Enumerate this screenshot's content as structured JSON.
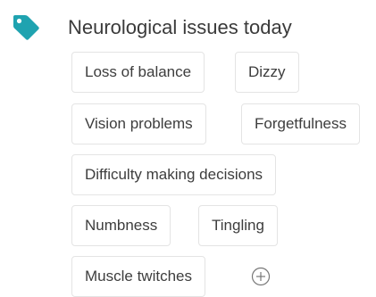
{
  "section": {
    "icon": "tag-icon",
    "title": "Neurological issues today"
  },
  "symptoms": [
    "Loss of balance",
    "Dizzy",
    "Vision problems",
    "Forgetfulness",
    "Difficulty making decisions",
    "Numbness",
    "Tingling",
    "Muscle twitches"
  ],
  "add_button": {
    "icon": "add-circle-icon"
  },
  "colors": {
    "accent": "#1fa3b0",
    "chip_border": "#e4e4e4",
    "text": "#3a3a3a"
  }
}
